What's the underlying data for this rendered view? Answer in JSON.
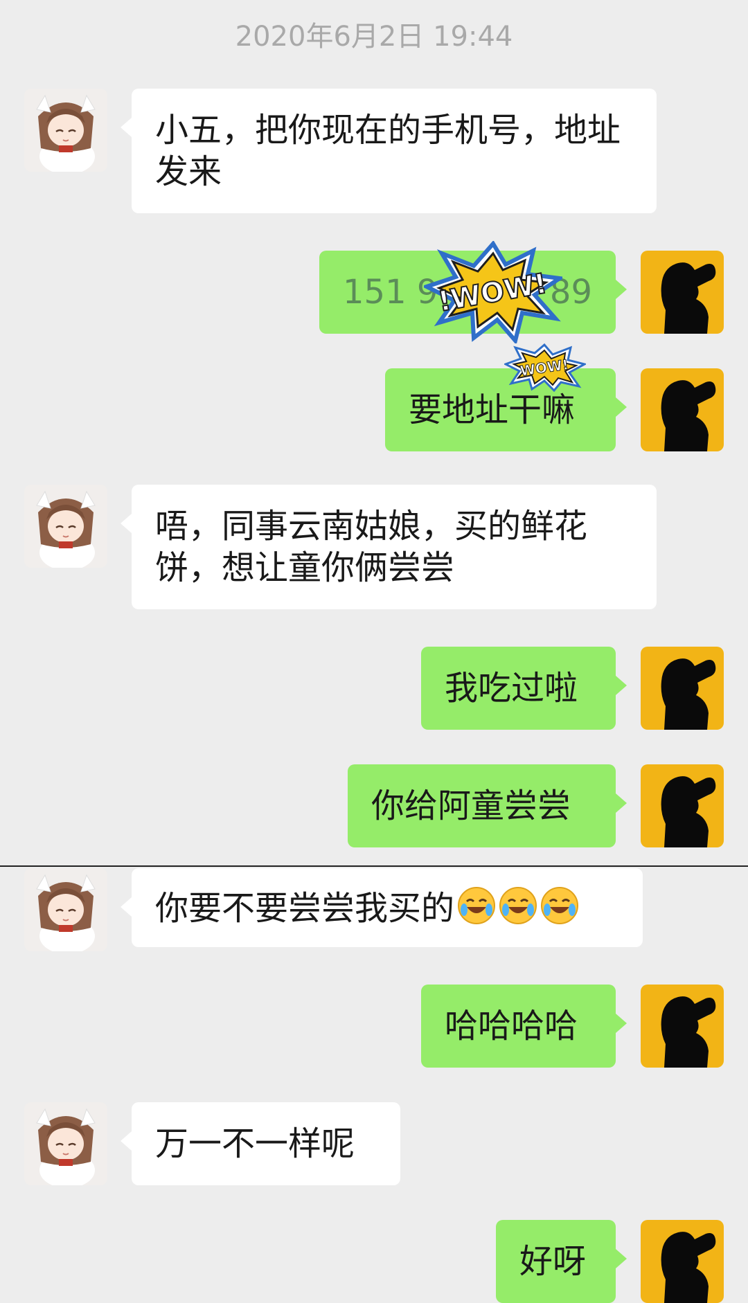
{
  "chat": {
    "timestamp": "2020年6月2日 19:44",
    "messages": [
      {
        "from": "them",
        "text": "小五，把你现在的手机号，地址发来"
      },
      {
        "from": "me",
        "text": "151 9",
        "text_tail": "89"
      },
      {
        "from": "me",
        "text": "要地址干嘛"
      },
      {
        "from": "them",
        "text": "唔，同事云南姑娘，买的鲜花饼，想让童你俩尝尝"
      },
      {
        "from": "me",
        "text": "我吃过啦"
      },
      {
        "from": "me",
        "text": "你给阿童尝尝"
      },
      {
        "from": "them",
        "text": "你要不要尝尝我买的"
      },
      {
        "from": "me",
        "text": "哈哈哈哈"
      },
      {
        "from": "them",
        "text": "万一不一样呢"
      },
      {
        "from": "me",
        "text": "好呀"
      }
    ],
    "stickers": {
      "large": "!WOW!",
      "small": "WOW!"
    },
    "emoji": [
      "face-with-tears-of-joy-icon",
      "face-with-tears-of-joy-icon",
      "face-with-tears-of-joy-icon"
    ]
  },
  "colors": {
    "background": "#EDEDED",
    "bubble_them": "#FFFFFF",
    "bubble_me": "#95EC69",
    "timestamp": "#A9A9A9",
    "my_avatar_bg": "#F2B416"
  }
}
